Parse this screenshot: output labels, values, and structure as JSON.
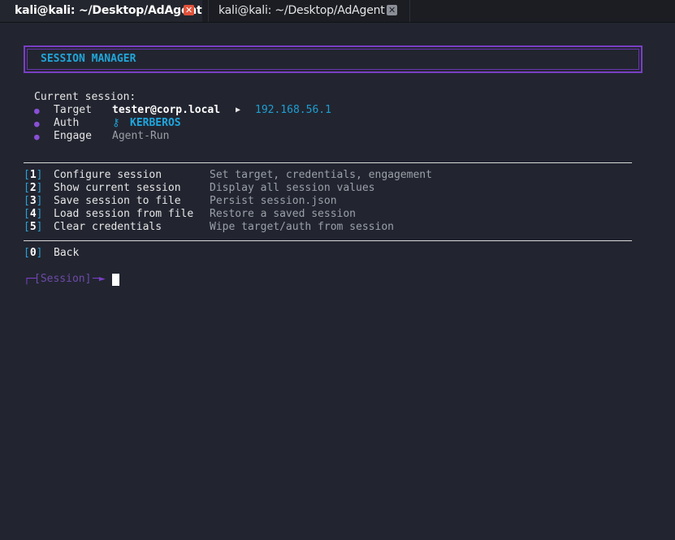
{
  "tabs": [
    {
      "label": "kali@kali: ~/Desktop/AdAgent",
      "active": true
    },
    {
      "label": "kali@kali: ~/Desktop/AdAgent",
      "active": false
    }
  ],
  "banner": {
    "title": "SESSION MANAGER"
  },
  "session": {
    "heading": "Current session:",
    "fields": [
      {
        "label": "Target",
        "value": "tester@corp.local",
        "arrow": "▶",
        "extra": "192.168.56.1"
      },
      {
        "label": "Auth",
        "icon": "⚷",
        "value": "KERBEROS"
      },
      {
        "label": "Engage",
        "value": "Agent-Run"
      }
    ]
  },
  "menu": {
    "items": [
      {
        "key": "1",
        "label": "Configure session",
        "desc": "Set target, credentials, engagement"
      },
      {
        "key": "2",
        "label": "Show current session",
        "desc": "Display all session values"
      },
      {
        "key": "3",
        "label": "Save session to file",
        "desc": "Persist session.json"
      },
      {
        "key": "4",
        "label": "Load session from file",
        "desc": "Restore a saved session"
      },
      {
        "key": "5",
        "label": "Clear credentials",
        "desc": "Wipe target/auth from session"
      }
    ],
    "back": {
      "key": "0",
      "label": "Back"
    }
  },
  "prompt": {
    "text": "[Session]"
  },
  "colors": {
    "background": "#222530",
    "accent_purple": "#7a3fc4",
    "accent_cyan": "#1f9ed1",
    "close_active": "#e0523a"
  },
  "icons": {
    "close": "close-icon",
    "auth": "key-icon",
    "target_arrow": "arrow-right-icon"
  }
}
